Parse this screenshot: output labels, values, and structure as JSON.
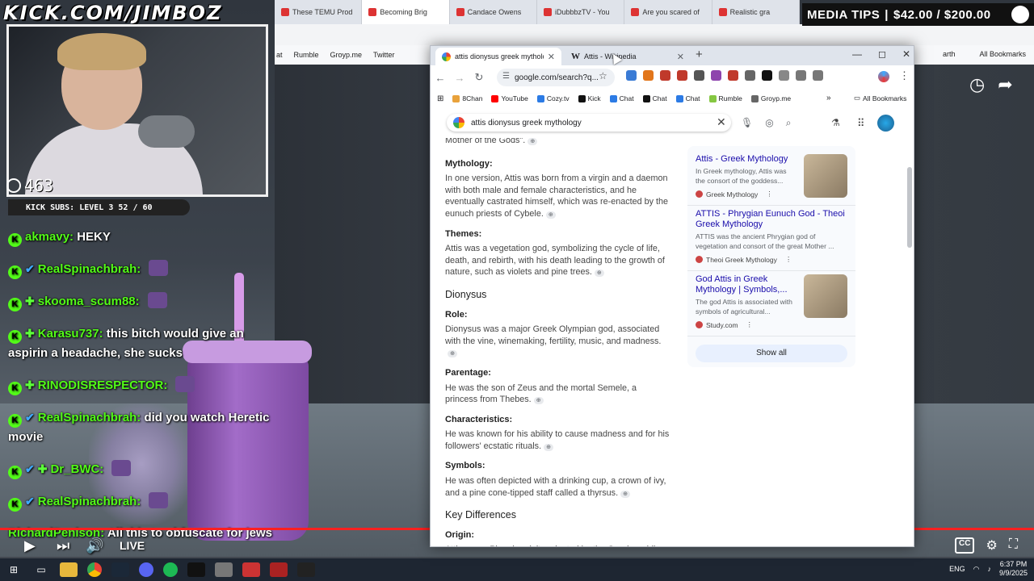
{
  "overlay": {
    "logo_text": "KICK.COM/JIMBOZ",
    "media_tips": {
      "label": "MEDIA TIPS",
      "sep": "|",
      "amount": "$42.00 / $200.00"
    },
    "viewer_count": "463",
    "subs_text": "KICK SUBS: LEVEL 3 52 / 60",
    "live_label": "LIVE"
  },
  "bg_browser": {
    "tabs": [
      "These TEMU Prod",
      "Becoming Brig",
      "Candace Owens",
      "iDubbbzTV - You",
      "Are you scared of",
      "Realistic gra"
    ],
    "bookmarks": [
      "at",
      "Rumble",
      "Groyp.me",
      "Twitter"
    ],
    "right_labels": [
      "arth",
      "All Bookmarks"
    ]
  },
  "chat": [
    {
      "user": "akmavy:",
      "text": "HEKY",
      "badges": [
        "kick"
      ],
      "emote": false
    },
    {
      "user": "RealSpinachbrah:",
      "text": "",
      "badges": [
        "kick",
        "verified"
      ],
      "emote": true
    },
    {
      "user": "skooma_scum88:",
      "text": "",
      "badges": [
        "kick",
        "sub"
      ],
      "emote": true
    },
    {
      "user": "Karasu737:",
      "text": "this bitch would give an aspirin a headache, she sucks",
      "badges": [
        "kick",
        "sub"
      ],
      "emote": false
    },
    {
      "user": "RINODISRESPECTOR:",
      "text": "",
      "badges": [
        "kick",
        "sub"
      ],
      "emote": true
    },
    {
      "user": "RealSpinachbrah:",
      "text": "did you watch Heretic movie",
      "badges": [
        "kick",
        "verified"
      ],
      "emote": false
    },
    {
      "user": "Dr_BWC:",
      "text": "",
      "badges": [
        "kick",
        "verified",
        "sub"
      ],
      "emote": true
    },
    {
      "user": "RealSpinachbrah:",
      "text": "",
      "badges": [
        "kick",
        "verified"
      ],
      "emote": true
    },
    {
      "user": "RichardPenison:",
      "text": "All this to obfuscate for jews",
      "badges": [],
      "emote": false
    }
  ],
  "chrome": {
    "tabs": [
      {
        "label": "attis dionysus greek mythology",
        "favicon": "google"
      },
      {
        "label": "Attis - Wikipedia",
        "favicon": "wikipedia"
      }
    ],
    "window_controls": [
      "—",
      "◻",
      "✕"
    ],
    "address": "google.com/search?q...",
    "bookmarks": [
      "8Chan",
      "YouTube",
      "Cozy.tv",
      "Kick",
      "Chat",
      "Chat",
      "Chat",
      "Rumble",
      "Groyp.me"
    ],
    "bookmarks_more": "»",
    "all_bookmarks": "All Bookmarks",
    "search_query": "attis dionysus greek mythology"
  },
  "result": {
    "cut_line": "Mother of the Gods\".",
    "attis_sections": [
      {
        "heading": "Mythology:",
        "text": "In one version, Attis was born from a virgin and a daemon with both male and female characteristics, and he eventually castrated himself, which was re-enacted by the eunuch priests of Cybele."
      },
      {
        "heading": "Themes:",
        "text": "Attis was a vegetation god, symbolizing the cycle of life, death, and rebirth, with his death leading to the growth of nature, such as violets and pine trees."
      }
    ],
    "dionysus_title": "Dionysus",
    "dionysus_sections": [
      {
        "heading": "Role:",
        "text": "Dionysus was a major Greek Olympian god, associated with the vine, winemaking, fertility, music, and madness."
      },
      {
        "heading": "Parentage:",
        "text": "He was the son of Zeus and the mortal Semele, a princess from Thebes."
      },
      {
        "heading": "Characteristics:",
        "text": "He was known for his ability to cause madness and for his followers' ecstatic rituals."
      },
      {
        "heading": "Symbols:",
        "text": "He was often depicted with a drinking cup, a crown of ivy, and a pine cone-tipped staff called a thyrsus."
      }
    ],
    "key_diff_title": "Key Differences",
    "origin_heading": "Origin:",
    "origin_text": "Attis was a Phrygian deity adopted by the Greeks, while"
  },
  "sources": [
    {
      "title": "Attis - Greek Mythology",
      "desc": "In Greek mythology, Attis was the consort of the goddess...",
      "site": "Greek Mythology",
      "thumb": true
    },
    {
      "title": "ATTIS - Phrygian Eunuch God - Theoi Greek Mythology",
      "desc": "ATTIS was the ancient Phrygian god of vegetation and consort of the great Mother ...",
      "site": "Theoi Greek Mythology",
      "thumb": false
    },
    {
      "title": "God Attis in Greek Mythology | Symbols,...",
      "desc": "The god Attis is associated with symbols of agricultural...",
      "site": "Study.com",
      "thumb": true
    }
  ],
  "show_all": "Show all",
  "taskbar": {
    "lang": "ENG",
    "time": "6:37 PM",
    "date": "9/9/2025"
  }
}
